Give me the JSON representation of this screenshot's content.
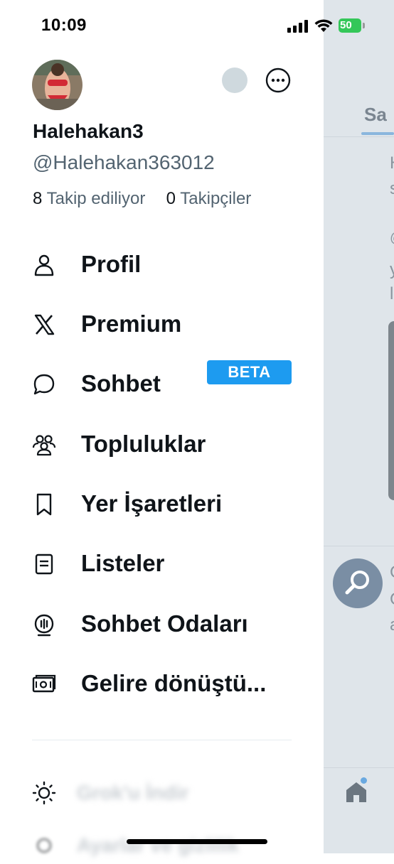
{
  "status_bar": {
    "time": "10:09",
    "battery": "50"
  },
  "profile": {
    "display_name": "Halehakan3",
    "handle": "@Halehakan363012",
    "following_count": "8",
    "following_label": "Takip ediliyor",
    "followers_count": "0",
    "followers_label": "Takipçiler"
  },
  "menu": {
    "items": [
      {
        "label": "Profil",
        "icon": "person-icon"
      },
      {
        "label": "Premium",
        "icon": "x-logo-icon"
      },
      {
        "label": "Sohbet",
        "icon": "chat-bubble-icon",
        "badge": "BETA"
      },
      {
        "label": "Topluluklar",
        "icon": "communities-icon"
      },
      {
        "label": "Yer İşaretleri",
        "icon": "bookmark-icon"
      },
      {
        "label": "Listeler",
        "icon": "list-icon"
      },
      {
        "label": "Sohbet Odaları",
        "icon": "spaces-icon"
      },
      {
        "label": "Gelire dönüştü...",
        "icon": "monetization-icon"
      }
    ]
  },
  "bottom_menu": {
    "items": [
      {
        "label": "Grok'u İndir",
        "icon": "sun-icon"
      },
      {
        "label": "Ayarlar ve gizlilik",
        "icon": "settings-icon"
      }
    ]
  },
  "background": {
    "tab_fragment": "Sa",
    "text_fragments": [
      "H",
      "s",
      "@",
      "y",
      "l",
      "C",
      "C",
      "a"
    ]
  },
  "colors": {
    "accent": "#1d9bf0",
    "text_primary": "#0f1419",
    "text_secondary": "#536471"
  }
}
